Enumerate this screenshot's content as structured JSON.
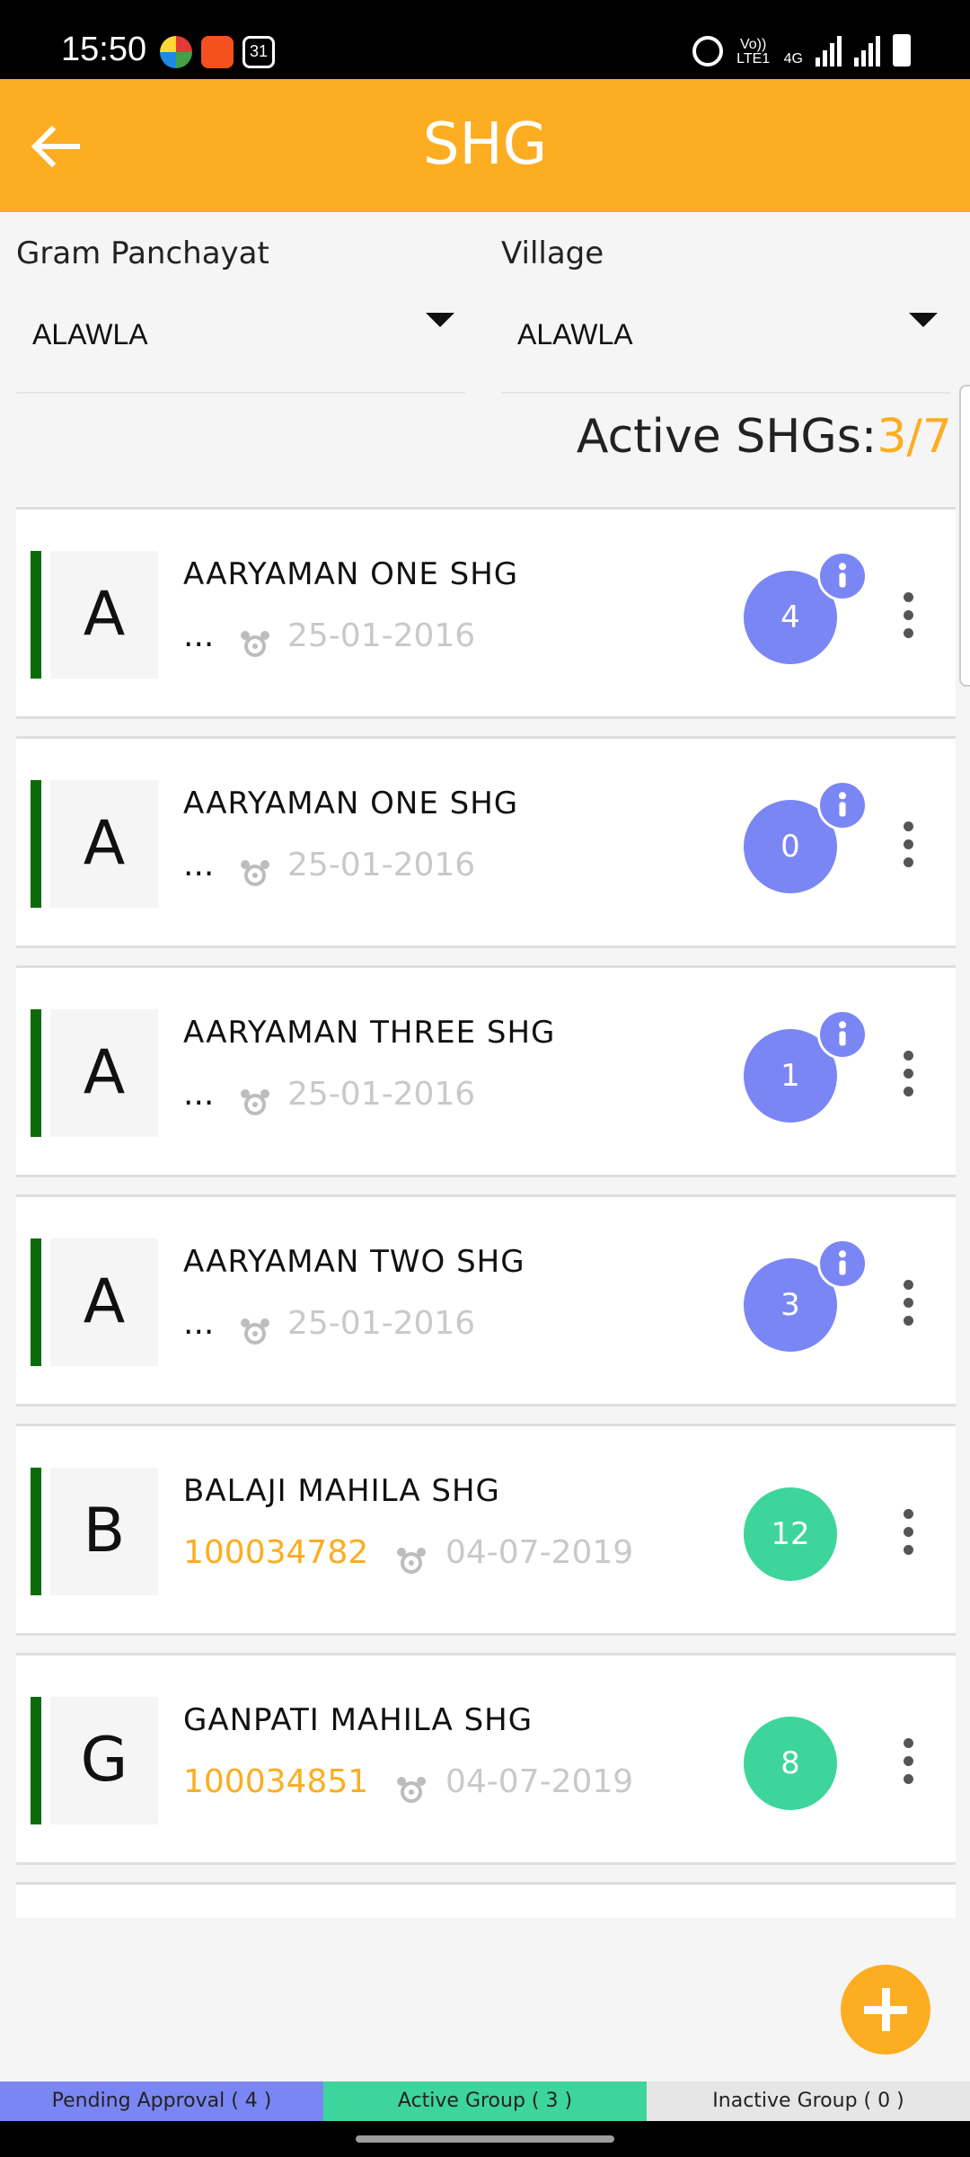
{
  "status_bar": {
    "time": "15:50",
    "calendar_day": "31",
    "network_label_top": "Vo)) LTE1",
    "network_label_4g": "4G"
  },
  "app_bar": {
    "title": "SHG"
  },
  "filters": {
    "gram_panchayat": {
      "label": "Gram Panchayat",
      "value": "ALAWLA"
    },
    "village": {
      "label": "Village",
      "value": "ALAWLA"
    }
  },
  "summary": {
    "label": "Active SHGs:",
    "count": "3/7"
  },
  "groups": [
    {
      "initial": "A",
      "name": "AARYAMAN ONE SHG",
      "code": "...",
      "date": "25-01-2016",
      "members": "4",
      "badge_color": "#7b86f5",
      "has_info": true
    },
    {
      "initial": "A",
      "name": "AARYAMAN ONE SHG",
      "code": "...",
      "date": "25-01-2016",
      "members": "0",
      "badge_color": "#7b86f5",
      "has_info": true
    },
    {
      "initial": "A",
      "name": "AARYAMAN THREE SHG",
      "code": "...",
      "date": "25-01-2016",
      "members": "1",
      "badge_color": "#7b86f5",
      "has_info": true
    },
    {
      "initial": "A",
      "name": "AARYAMAN TWO SHG",
      "code": "...",
      "date": "25-01-2016",
      "members": "3",
      "badge_color": "#7b86f5",
      "has_info": true
    },
    {
      "initial": "B",
      "name": "BALAJI MAHILA SHG",
      "code": "100034782",
      "date": "04-07-2019",
      "members": "12",
      "badge_color": "#3dd59b",
      "has_info": false
    },
    {
      "initial": "G",
      "name": "GANPATI MAHILA SHG",
      "code": "100034851",
      "date": "04-07-2019",
      "members": "8",
      "badge_color": "#3dd59b",
      "has_info": false
    }
  ],
  "tabs": {
    "pending": "Pending Approval ( 4 )",
    "active": "Active Group ( 3 )",
    "inactive": "Inactive Group ( 0 )"
  },
  "colors": {
    "primary": "#fdad21",
    "badge_blue": "#7b86f5",
    "badge_green": "#3dd59b",
    "status_bar_green": "#0b6b0b"
  }
}
